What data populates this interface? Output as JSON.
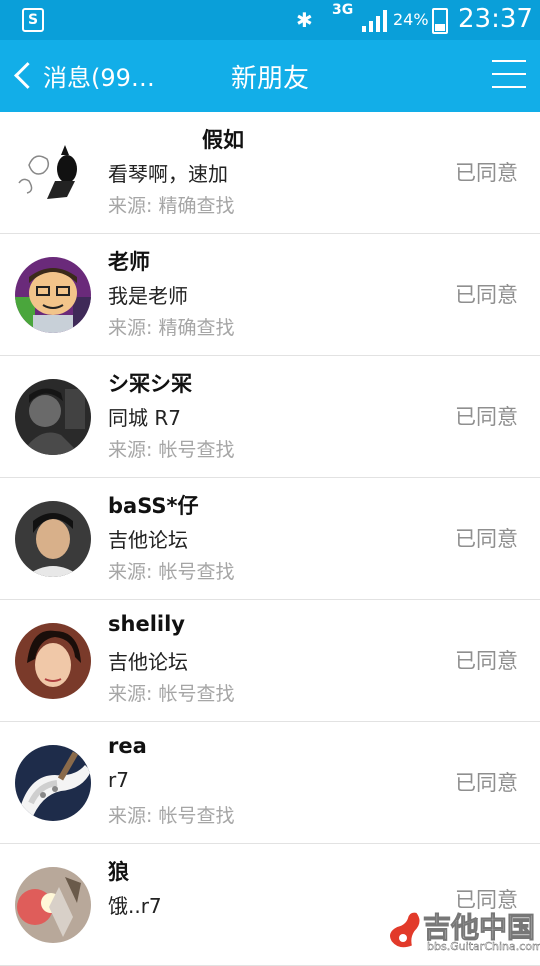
{
  "status_bar": {
    "network": "3G",
    "battery": "24%",
    "time": "23:37"
  },
  "header": {
    "back_label": "消息(99…",
    "title": "新朋友"
  },
  "friends": [
    {
      "name": "假如",
      "message": "看琴啊，速加",
      "source": "来源: 精确查找",
      "status": "已同意"
    },
    {
      "name": "老师",
      "message": "我是老师",
      "source": "来源: 精确查找",
      "status": "已同意"
    },
    {
      "name": "シ冞シ冞",
      "message": "同城 R7",
      "source": "来源: 帐号查找",
      "status": "已同意"
    },
    {
      "name": "baSS*仔",
      "message": "吉他论坛",
      "source": "来源: 帐号查找",
      "status": "已同意"
    },
    {
      "name": "shelily",
      "message": "吉他论坛",
      "source": "来源: 帐号查找",
      "status": "已同意"
    },
    {
      "name": "rea",
      "message": "r7",
      "source": "来源: 帐号查找",
      "status": "已同意"
    },
    {
      "name": "狼",
      "message": "饿..r7",
      "source": "",
      "status": "已同意"
    }
  ],
  "watermark": {
    "brand": "吉他中国",
    "url": "bbs.GuitarChina.com"
  },
  "colors": {
    "header_bg": "#12aee8",
    "status_text": "#8f8f8f",
    "source_text": "#a6a6a6"
  }
}
